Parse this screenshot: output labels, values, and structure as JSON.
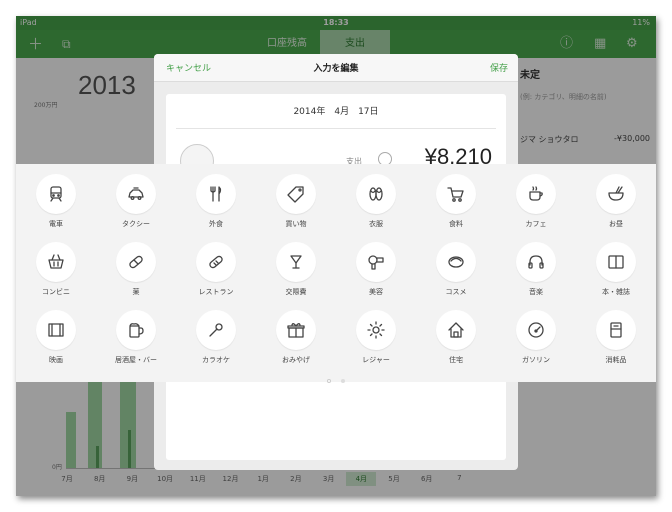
{
  "status": {
    "device": "iPad",
    "time": "18:33",
    "battery": "11%"
  },
  "nav": {
    "tab_balance": "口座残高",
    "tab_expense": "支出"
  },
  "background": {
    "year": "2013",
    "y_top_label": "200万円",
    "y_zero_label": "0円",
    "months": [
      "7月",
      "8月",
      "9月",
      "10月",
      "11月",
      "12月",
      "1月",
      "2月",
      "3月",
      "4月",
      "5月",
      "6月",
      "7"
    ],
    "selected_month": "4月",
    "right_title": "未定",
    "right_search": "(例: カテゴリ、明細の名前)",
    "right_row_name": "ジマ ショウタロ",
    "right_row_amount": "-¥30,000"
  },
  "modal": {
    "cancel_label": "キャンセル",
    "title": "入力を編集",
    "save_label": "保存",
    "date": "2014年　4月　17日",
    "type_label": "支出",
    "amount": "¥8,210"
  },
  "categories": [
    {
      "label": "電車",
      "icon": "train-icon"
    },
    {
      "label": "タクシー",
      "icon": "taxi-icon"
    },
    {
      "label": "外食",
      "icon": "fork-knife-icon"
    },
    {
      "label": "買い物",
      "icon": "tag-icon"
    },
    {
      "label": "衣服",
      "icon": "sandals-icon"
    },
    {
      "label": "食料",
      "icon": "cart-icon"
    },
    {
      "label": "カフェ",
      "icon": "coffee-icon"
    },
    {
      "label": "お昼",
      "icon": "bowl-icon"
    },
    {
      "label": "コンビニ",
      "icon": "basket-icon"
    },
    {
      "label": "薬",
      "icon": "pill-icon"
    },
    {
      "label": "レストラン",
      "icon": "bread-icon"
    },
    {
      "label": "交際費",
      "icon": "cocktail-icon"
    },
    {
      "label": "美容",
      "icon": "hairdryer-icon"
    },
    {
      "label": "コスメ",
      "icon": "compact-icon"
    },
    {
      "label": "音楽",
      "icon": "headphones-icon"
    },
    {
      "label": "本・雑誌",
      "icon": "book-icon"
    },
    {
      "label": "映画",
      "icon": "film-icon"
    },
    {
      "label": "居酒屋・バー",
      "icon": "beer-icon"
    },
    {
      "label": "カラオケ",
      "icon": "microphone-icon"
    },
    {
      "label": "おみやげ",
      "icon": "gift-icon"
    },
    {
      "label": "レジャー",
      "icon": "sun-icon"
    },
    {
      "label": "住宅",
      "icon": "house-icon"
    },
    {
      "label": "ガソリン",
      "icon": "gauge-icon"
    },
    {
      "label": "消耗品",
      "icon": "box-icon"
    }
  ],
  "colors": {
    "accent": "#46a24a",
    "tab_active": "#a8d6aa"
  }
}
